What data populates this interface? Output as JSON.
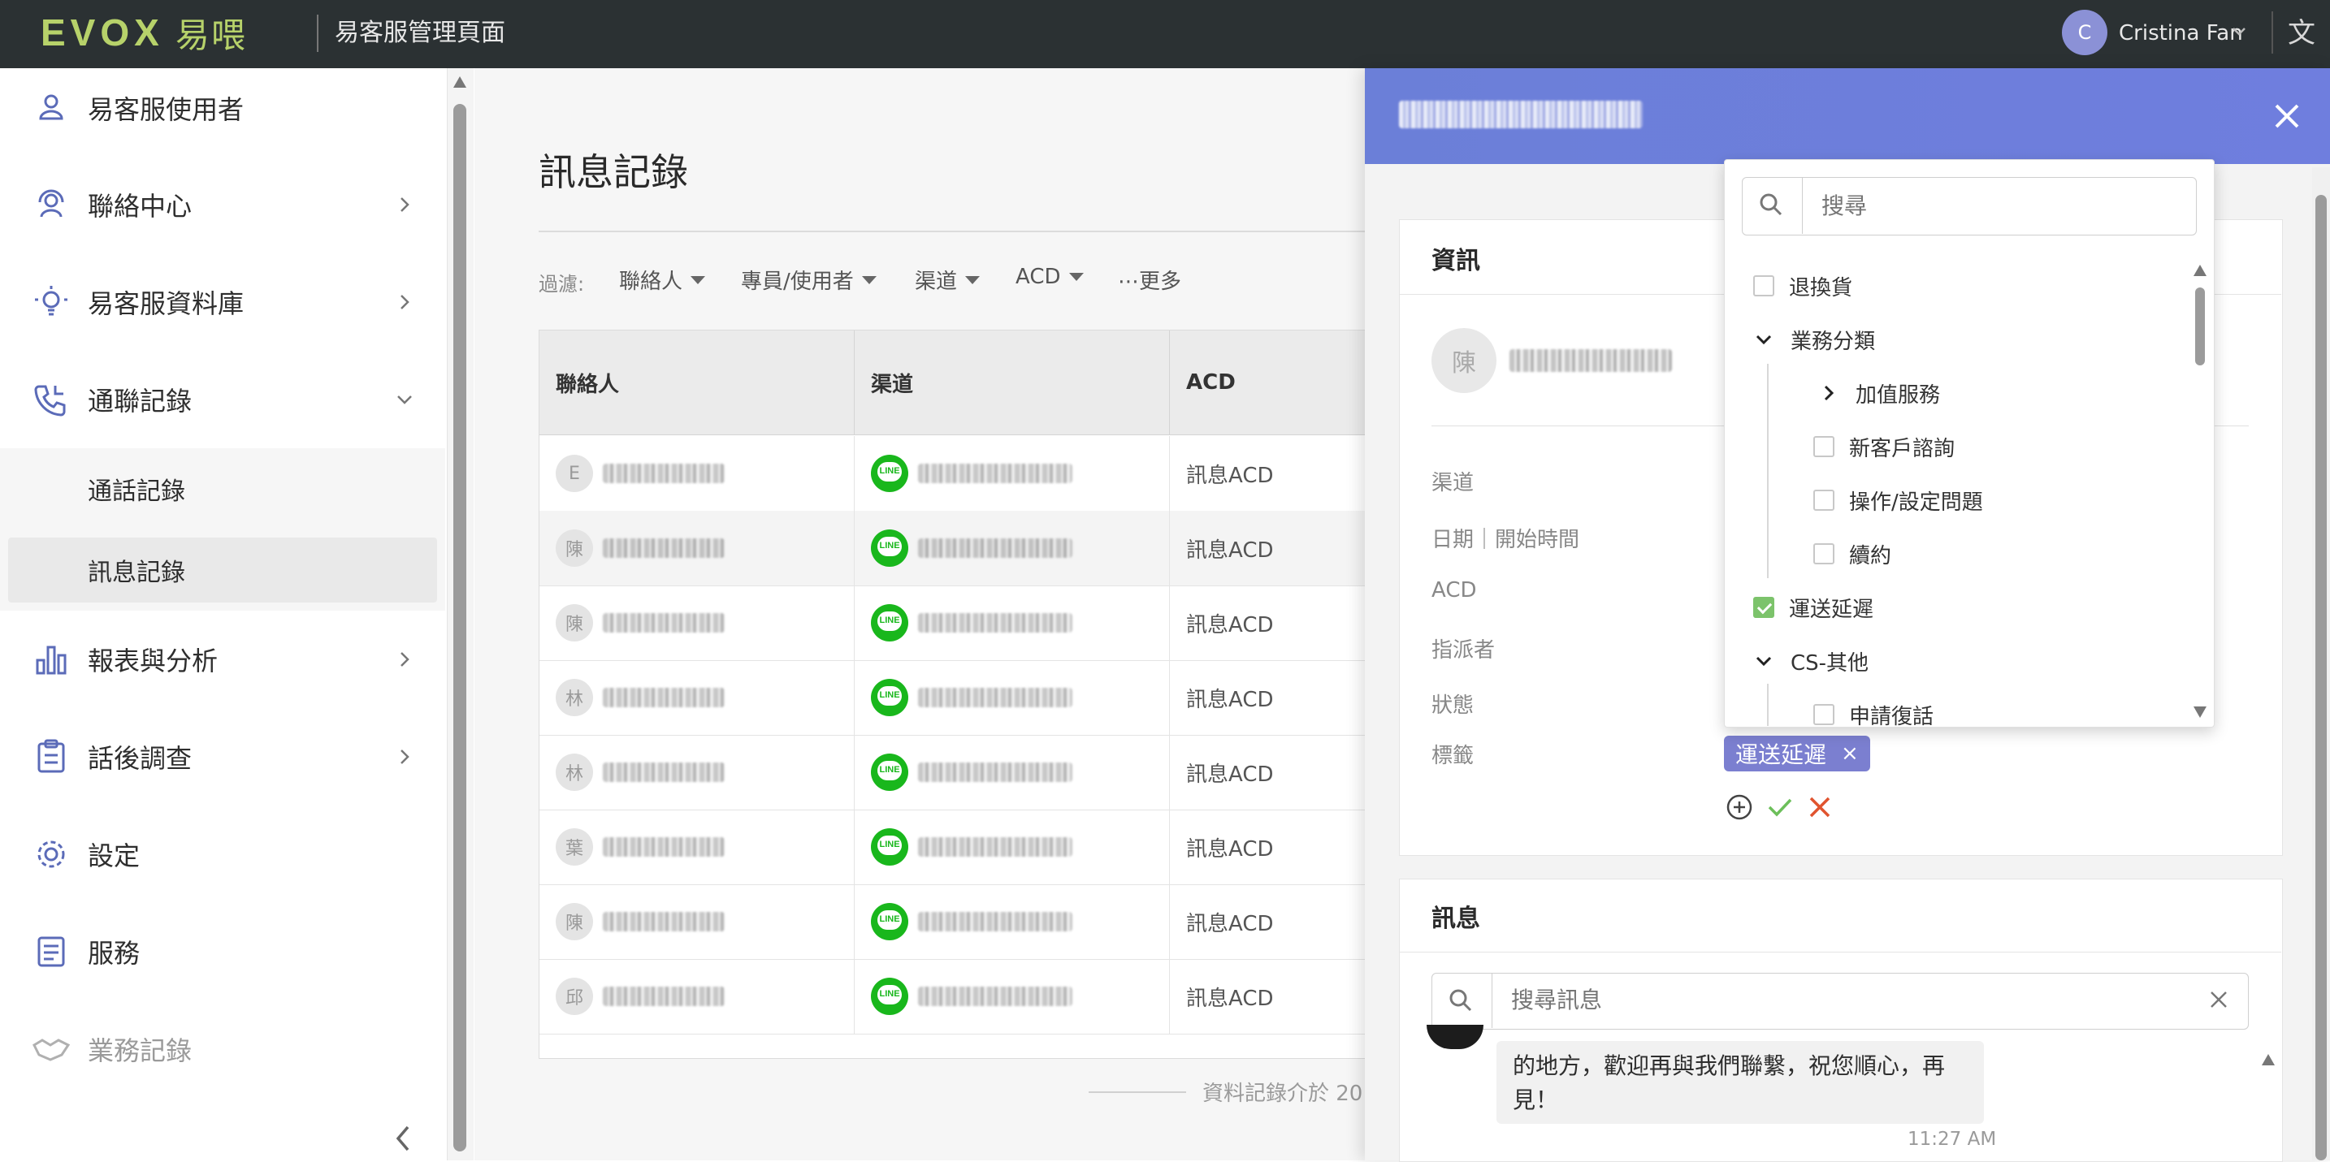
{
  "brand": {
    "logo_text": "EVOX",
    "logo_cn": "易喂",
    "portal_title": "易客服管理頁面"
  },
  "user": {
    "initial": "C",
    "name": "Cristina Fan"
  },
  "sidebar": {
    "items": [
      {
        "label": "易客服使用者",
        "icon": "user-icon"
      },
      {
        "label": "聯絡中心",
        "icon": "headset-agent-icon"
      },
      {
        "label": "易客服資料庫",
        "icon": "lightbulb-icon"
      },
      {
        "label": "通聯記錄",
        "icon": "phone-log-icon"
      },
      {
        "label": "報表與分析",
        "icon": "bar-chart-icon"
      },
      {
        "label": "話後調查",
        "icon": "clipboard-icon"
      },
      {
        "label": "設定",
        "icon": "gear-icon"
      },
      {
        "label": "服務",
        "icon": "service-list-icon"
      },
      {
        "label": "業務記錄",
        "icon": "handshake-icon"
      }
    ],
    "sub_items": [
      {
        "label": "通話記錄"
      },
      {
        "label": "訊息記錄",
        "active": true
      }
    ]
  },
  "main": {
    "title": "訊息記錄",
    "filter_label": "過濾:",
    "filters": [
      "聯絡人",
      "專員/使用者",
      "渠道",
      "ACD",
      "⋯更多"
    ],
    "columns": [
      "聯絡人",
      "渠道",
      "ACD"
    ],
    "rows": [
      {
        "initial": "E",
        "acd": "訊息ACD"
      },
      {
        "initial": "陳",
        "acd": "訊息ACD"
      },
      {
        "initial": "陳",
        "acd": "訊息ACD"
      },
      {
        "initial": "林",
        "acd": "訊息ACD"
      },
      {
        "initial": "林",
        "acd": "訊息ACD"
      },
      {
        "initial": "葉",
        "acd": "訊息ACD"
      },
      {
        "initial": "陳",
        "acd": "訊息ACD"
      },
      {
        "initial": "邱",
        "acd": "訊息ACD"
      }
    ],
    "line_badge": "LINE",
    "footer_note": "資料記錄介於 20"
  },
  "panel": {
    "info_title": "資訊",
    "contact_initial": "陳",
    "fields": [
      "渠道",
      "日期｜開始時間",
      "ACD",
      "指派者",
      "狀態",
      "標籤"
    ],
    "tag_chip": "運送延遲",
    "tag_chip_remove": "×",
    "messages_title": "訊息",
    "message_search_placeholder": "搜尋訊息",
    "message_text": "的地方，歡迎再與我們聯繫，祝您順心，再見！",
    "message_time": "11:27 AM"
  },
  "dropdown": {
    "search_placeholder": "搜尋",
    "tree": [
      {
        "label": "退換貨",
        "type": "checkbox",
        "checked": false
      },
      {
        "label": "業務分類",
        "type": "expanded"
      },
      {
        "label": "加值服務",
        "type": "collapsed"
      },
      {
        "label": "新客戶諮詢",
        "type": "checkbox",
        "checked": false
      },
      {
        "label": "操作/設定問題",
        "type": "checkbox",
        "checked": false
      },
      {
        "label": "續約",
        "type": "checkbox",
        "checked": false
      },
      {
        "label": "運送延遲",
        "type": "checkbox",
        "checked": true
      },
      {
        "label": "CS-其他",
        "type": "expanded"
      },
      {
        "label": "申請復話",
        "type": "checkbox",
        "checked": false
      }
    ]
  },
  "colors": {
    "accent": "#6f7ede",
    "tag": "#7b7fd0",
    "topbar": "#2b3133",
    "brand_green": "#b7d26a",
    "line_green": "#19b71c",
    "check_green": "#7cc36b"
  }
}
